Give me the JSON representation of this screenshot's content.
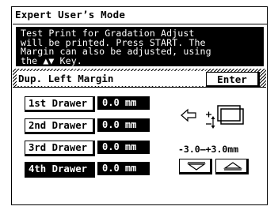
{
  "header": {
    "title": "Expert User’s Mode"
  },
  "message": {
    "lines": [
      "Test Print for Gradation Adjust",
      "will be printed. Press START. The",
      "Margin can also be adjusted, using",
      "the ▲▼ Key."
    ]
  },
  "section": {
    "label": "Dup. Left Margin",
    "enter_label": "Enter"
  },
  "drawers": [
    {
      "label": "1st Drawer",
      "value": "0.0 mm",
      "selected": false
    },
    {
      "label": "2nd Drawer",
      "value": "0.0 mm",
      "selected": false
    },
    {
      "label": "3rd Drawer",
      "value": "0.0 mm",
      "selected": false
    },
    {
      "label": "4th Drawer",
      "value": "0.0 mm",
      "selected": true
    }
  ],
  "adjust": {
    "range": "-3.0–+3.0mm",
    "down_icon": "down-triangle-icon",
    "up_icon": "up-triangle-icon",
    "diagram_icons": [
      "left-arrow-icon",
      "margin-diagram-icon"
    ]
  },
  "colors": {
    "foreground": "#000000",
    "background": "#ffffff"
  }
}
